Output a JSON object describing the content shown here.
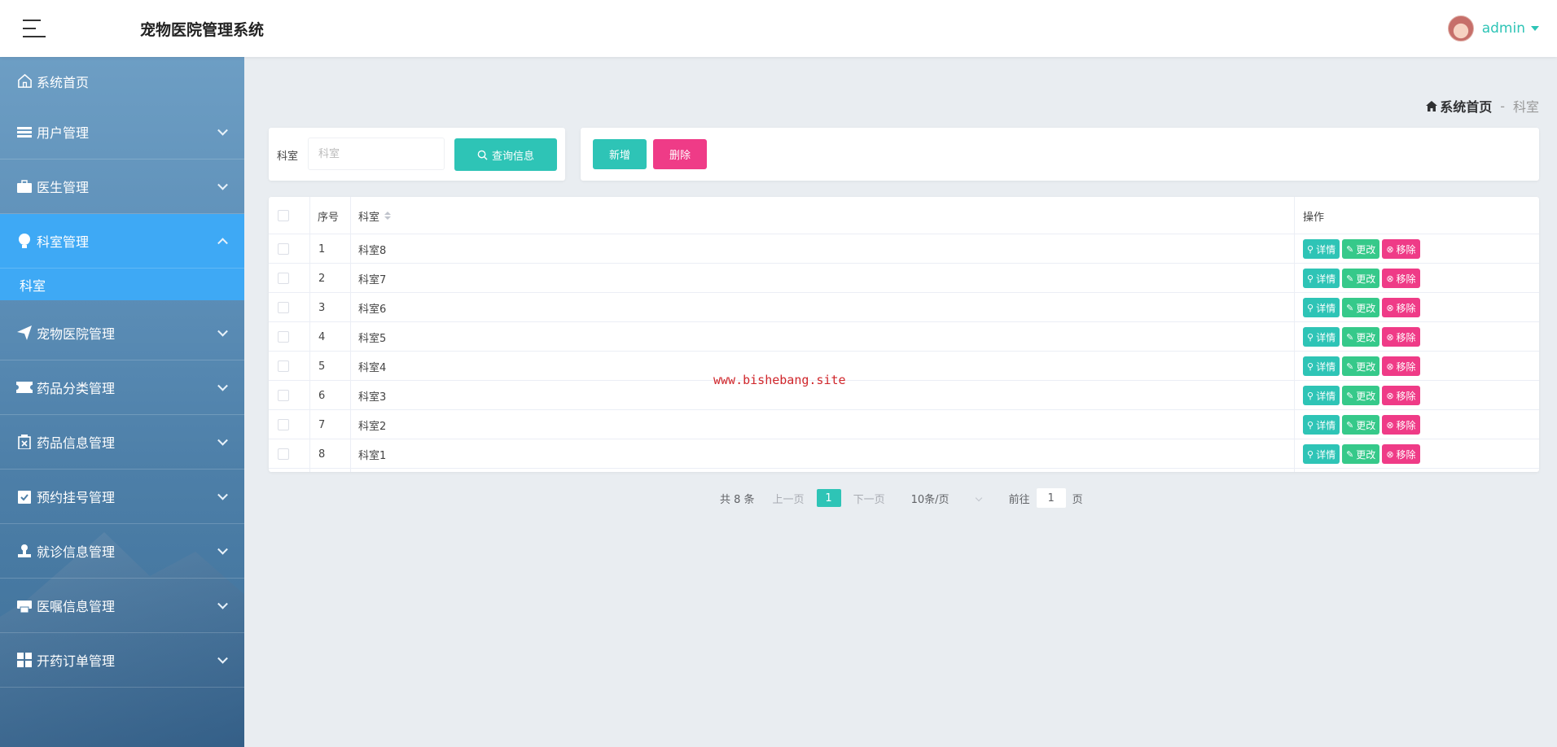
{
  "header": {
    "title": "宠物医院管理系统",
    "username": "admin"
  },
  "sidebar": {
    "home": {
      "label": "系统首页",
      "icon": "home-icon"
    },
    "items": [
      {
        "label": "用户管理",
        "icon": "user-list-icon"
      },
      {
        "label": "医生管理",
        "icon": "briefcase-icon"
      },
      {
        "label": "科室管理",
        "icon": "lightbulb-icon",
        "active": true,
        "expanded": true
      },
      {
        "label": "宠物医院管理",
        "icon": "paper-plane-icon"
      },
      {
        "label": "药品分类管理",
        "icon": "ticket-icon"
      },
      {
        "label": "药品信息管理",
        "icon": "medicine-box-icon"
      },
      {
        "label": "预约挂号管理",
        "icon": "clipboard-check-icon"
      },
      {
        "label": "就诊信息管理",
        "icon": "stamp-icon"
      },
      {
        "label": "医嘱信息管理",
        "icon": "printer-icon"
      },
      {
        "label": "开药订单管理",
        "icon": "grid-icon"
      }
    ],
    "sub_items": [
      {
        "label": "科室"
      }
    ]
  },
  "breadcrumb": {
    "home": "系统首页",
    "separator": "-",
    "current": "科室"
  },
  "search": {
    "label": "科室",
    "placeholder": "科室",
    "button": "查询信息"
  },
  "actions": {
    "add": "新增",
    "delete": "删除"
  },
  "table": {
    "headers": {
      "index": "序号",
      "name": "科室",
      "operations": "操作"
    },
    "row_buttons": {
      "detail": "详情",
      "edit": "更改",
      "remove": "移除"
    },
    "rows": [
      {
        "index": "1",
        "name": "科室8"
      },
      {
        "index": "2",
        "name": "科室7"
      },
      {
        "index": "3",
        "name": "科室6"
      },
      {
        "index": "4",
        "name": "科室5"
      },
      {
        "index": "5",
        "name": "科室4"
      },
      {
        "index": "6",
        "name": "科室3"
      },
      {
        "index": "7",
        "name": "科室2"
      },
      {
        "index": "8",
        "name": "科室1"
      }
    ]
  },
  "watermark": "www.bishebang.site",
  "pagination": {
    "total": "共 8 条",
    "prev": "上一页",
    "current_page": "1",
    "next": "下一页",
    "page_size": "10条/页",
    "goto_prefix": "前往",
    "goto_value": "1",
    "goto_suffix": "页"
  },
  "colors": {
    "accent": "#2ec4b6",
    "danger": "#ef3b87",
    "edit": "#36c98a",
    "nav_active": "#3ea9f5"
  }
}
